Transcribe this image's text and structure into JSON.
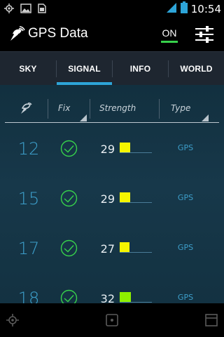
{
  "status_bar": {
    "time": "10:54",
    "icons": [
      "gps-icon",
      "image-icon",
      "sim-icon",
      "signal-icon",
      "battery-icon"
    ]
  },
  "action_bar": {
    "app_title": "GPS Data",
    "toggle_label": "ON",
    "toggle_color": "#37d14b",
    "icons": [
      "satellite-dish-icon",
      "sliders-icon"
    ]
  },
  "tabs": [
    {
      "label": "SKY"
    },
    {
      "label": "SIGNAL",
      "selected": true
    },
    {
      "label": "INFO"
    },
    {
      "label": "WORLD"
    }
  ],
  "accent_color": "#2da4d8",
  "table": {
    "headers": {
      "satellite_icon": "satellite-icon",
      "fix": "Fix",
      "strength": "Strength",
      "type": "Type"
    },
    "rows": [
      {
        "prn": "12",
        "fix": true,
        "snr": "29",
        "snr_value": 29,
        "snr_color": "#f5f500",
        "type": "GPS"
      },
      {
        "prn": "15",
        "fix": true,
        "snr": "29",
        "snr_value": 29,
        "snr_color": "#f5f500",
        "type": "GPS"
      },
      {
        "prn": "17",
        "fix": true,
        "snr": "27",
        "snr_value": 27,
        "snr_color": "#f5f500",
        "type": "GPS"
      },
      {
        "prn": "18",
        "fix": true,
        "snr": "32",
        "snr_value": 32,
        "snr_color": "#8ef000",
        "type": "GPS"
      }
    ]
  },
  "nav_bar": {
    "icons": [
      "back-icon",
      "home-icon",
      "recents-icon"
    ]
  }
}
